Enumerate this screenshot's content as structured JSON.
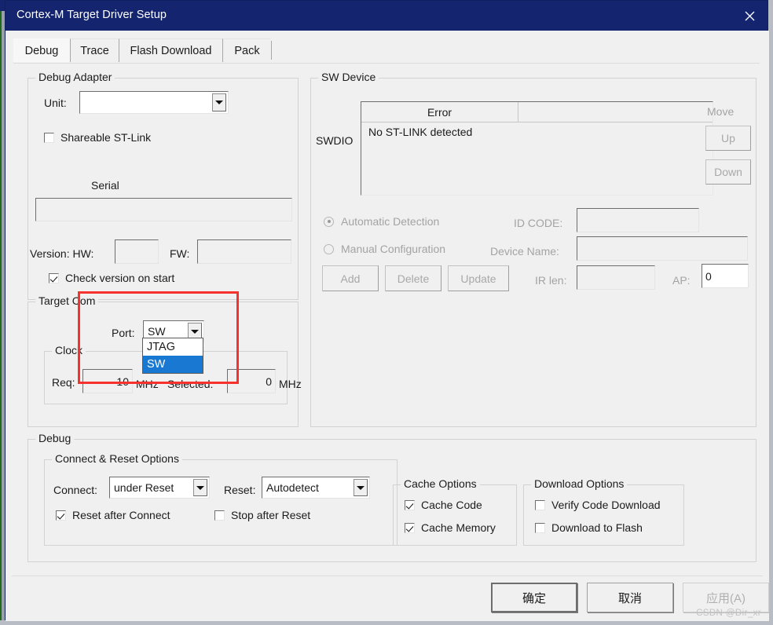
{
  "window": {
    "title": "Cortex-M Target Driver Setup",
    "close_icon": "close-icon",
    "titlebar_color": "#14246e"
  },
  "tabs": [
    {
      "label": "Debug",
      "active": true
    },
    {
      "label": "Trace",
      "active": false
    },
    {
      "label": "Flash Download",
      "active": false
    },
    {
      "label": "Pack",
      "active": false
    }
  ],
  "debug_adapter": {
    "legend": "Debug Adapter",
    "unit_label": "Unit:",
    "unit_value": "",
    "shareable_label": "Shareable ST-Link",
    "shareable_checked": false,
    "serial_label": "Serial",
    "serial_value": "",
    "version_label": "Version: HW:",
    "hw_value": "",
    "fw_label": "FW:",
    "fw_value": "",
    "check_version_label": "Check version on start",
    "check_version_checked": true
  },
  "target_com": {
    "legend": "Target Com",
    "port_label": "Port:",
    "port_value": "SW",
    "port_options": [
      "JTAG",
      "SW"
    ],
    "port_selected_option": "SW",
    "dropdown_open": true,
    "clock": {
      "legend": "Clock",
      "req_label": "Req:",
      "req_value": "10",
      "req_unit": "MHz",
      "selected_label": "Selected:",
      "selected_value": "0",
      "selected_unit": "MHz"
    }
  },
  "sw_device": {
    "legend": "SW Device",
    "swdio_label": "SWDIO",
    "columns": [
      "Error",
      ""
    ],
    "rows": [
      [
        "No ST-LINK detected",
        ""
      ]
    ],
    "move_label": "Move",
    "up_label": "Up",
    "down_label": "Down",
    "automatic_detection_label": "Automatic Detection",
    "automatic_detection_selected": true,
    "manual_configuration_label": "Manual Configuration",
    "manual_configuration_selected": false,
    "id_code_label": "ID CODE:",
    "id_code_value": "",
    "device_name_label": "Device Name:",
    "device_name_value": "",
    "ir_len_label": "IR len:",
    "ir_len_value": "",
    "ap_label": "AP:",
    "ap_value": "0",
    "add_label": "Add",
    "delete_label": "Delete",
    "update_label": "Update"
  },
  "debug_section": {
    "legend": "Debug",
    "connect_reset": {
      "legend": "Connect & Reset Options",
      "connect_label": "Connect:",
      "connect_value": "under Reset",
      "reset_label": "Reset:",
      "reset_value": "Autodetect",
      "reset_after_connect_label": "Reset after Connect",
      "reset_after_connect_checked": true,
      "stop_after_reset_label": "Stop after Reset",
      "stop_after_reset_checked": false
    },
    "cache_options": {
      "legend": "Cache Options",
      "cache_code_label": "Cache Code",
      "cache_code_checked": true,
      "cache_memory_label": "Cache Memory",
      "cache_memory_checked": true
    },
    "download_options": {
      "legend": "Download Options",
      "verify_code_download_label": "Verify Code Download",
      "verify_code_download_checked": false,
      "download_to_flash_label": "Download to Flash",
      "download_to_flash_checked": false
    }
  },
  "footer": {
    "ok_label": "确定",
    "cancel_label": "取消",
    "apply_label": "应用(A)",
    "apply_disabled": true
  },
  "annotation": {
    "color": "#f5322e",
    "shape": "rectangle"
  },
  "watermark": "CSDN @Dir_xr"
}
